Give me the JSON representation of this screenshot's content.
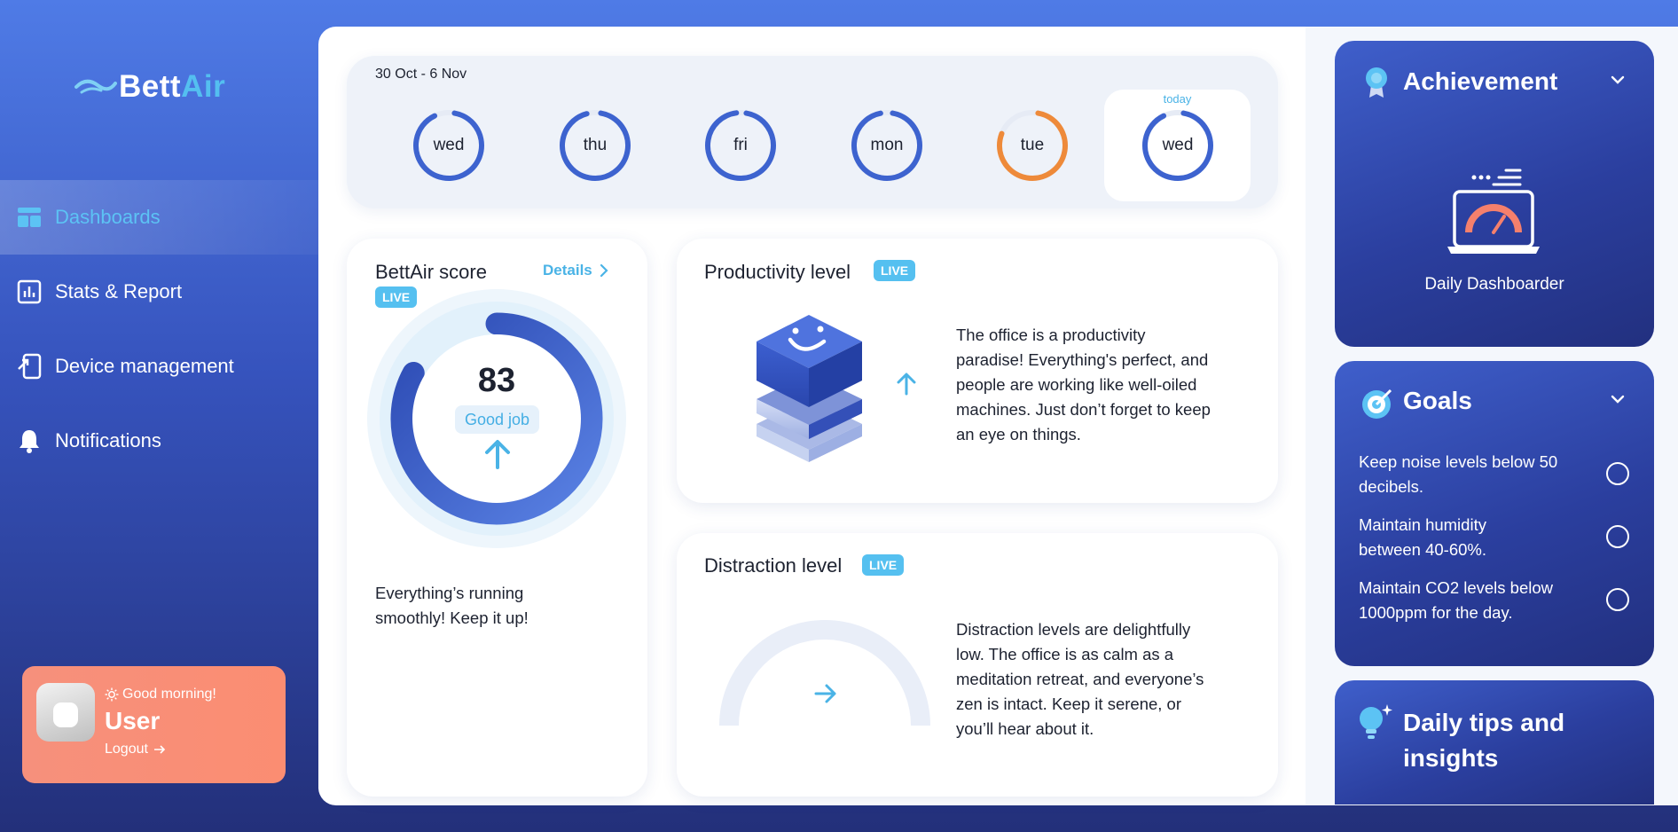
{
  "brand": {
    "name_part1": "Bett",
    "name_part2": "Air"
  },
  "sidebar": {
    "items": [
      {
        "label": "Dashboards",
        "icon": "dashboard-icon",
        "active": true
      },
      {
        "label": "Stats & Report",
        "icon": "bar-chart-icon"
      },
      {
        "label": "Device management",
        "icon": "device-icon"
      },
      {
        "label": "Notifications",
        "icon": "bell-icon"
      }
    ],
    "user": {
      "greeting": "Good morning!",
      "name": "User",
      "logout": "Logout"
    }
  },
  "week": {
    "range": "30 Oct - 6 Nov",
    "today_label": "today",
    "days": [
      {
        "label": "wed",
        "progress": 0.9,
        "color": "#3d63cf"
      },
      {
        "label": "thu",
        "progress": 0.93,
        "color": "#3d63cf"
      },
      {
        "label": "fri",
        "progress": 0.95,
        "color": "#3d63cf"
      },
      {
        "label": "mon",
        "progress": 0.94,
        "color": "#3d63cf"
      },
      {
        "label": "tue",
        "progress": 0.78,
        "color": "#ee8a3a"
      },
      {
        "label": "wed",
        "progress": 0.9,
        "color": "#3d63cf",
        "today": true
      }
    ]
  },
  "score_card": {
    "title": "BettAir score",
    "live": "LIVE",
    "details": "Details",
    "score": "83",
    "score_value": 83,
    "badge": "Good job",
    "message": [
      "Everything’s running",
      "smoothly! Keep it up!"
    ]
  },
  "productivity": {
    "title": "Productivity level",
    "live": "LIVE",
    "text": [
      "The office is a productivity",
      "paradise! Everything's perfect, and",
      "people are working like well-oiled",
      "machines. Just don’t forget to keep",
      "an eye on things."
    ]
  },
  "distraction": {
    "title": "Distraction level",
    "live": "LIVE",
    "text": [
      "Distraction levels are delightfully",
      "low. The office is as calm as a",
      "meditation retreat, and everyone’s",
      "zen is intact. Keep it serene, or",
      "you’ll hear about it."
    ]
  },
  "achievement": {
    "title": "Achievement",
    "item": "Daily Dashboarder"
  },
  "goals": {
    "title": "Goals",
    "items": [
      [
        "Keep noise levels below 50",
        "decibels."
      ],
      [
        "Maintain humidity",
        "between 40-60%."
      ],
      [
        "Maintain CO2 levels below",
        "1000ppm for the day."
      ]
    ]
  },
  "tips": {
    "title": [
      "Daily tips and",
      "insights"
    ]
  },
  "colors": {
    "accent": "#55c0f0",
    "primary": "#3d63cf",
    "warning": "#ee8a3a",
    "user_card": "#f8907a"
  }
}
